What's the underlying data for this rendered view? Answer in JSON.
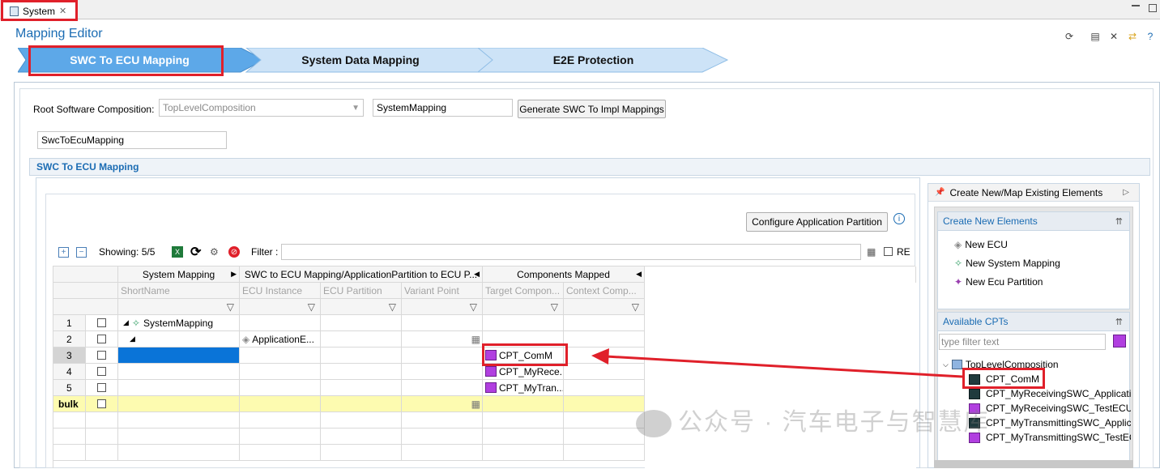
{
  "tab": {
    "label": "System"
  },
  "editor": {
    "title": "Mapping Editor"
  },
  "steps": [
    "SWC To ECU Mapping",
    "System Data Mapping",
    "E2E Protection"
  ],
  "form": {
    "root_label": "Root Software Composition:",
    "root_value": "TopLevelComposition",
    "system_mapping_value": "SystemMapping",
    "generate_button": "Generate SWC To Impl Mappings",
    "swc_to_ecu_value": "SwcToEcuMapping"
  },
  "section": {
    "title": "SWC To ECU Mapping"
  },
  "toolbar": {
    "configure_button": "Configure Application Partition",
    "showing": "Showing: 5/5",
    "filter_label": "Filter :",
    "re_label": "RE"
  },
  "table": {
    "group_headers": [
      "System Mapping",
      "SWC to ECU Mapping/ApplicationPartition to ECU P...",
      "Components Mapped"
    ],
    "columns": [
      "ShortName",
      "ECU Instance",
      "ECU Partition",
      "Variant Point",
      "Target Compon...",
      "Context Comp..."
    ],
    "rows": [
      {
        "num": "1",
        "short": "SystemMapping",
        "ecu": "",
        "target": ""
      },
      {
        "num": "2",
        "short": "",
        "ecu": "ApplicationE...",
        "target": ""
      },
      {
        "num": "3",
        "short": "",
        "ecu": "",
        "target": "CPT_ComM"
      },
      {
        "num": "4",
        "short": "",
        "ecu": "",
        "target": "CPT_MyRece..."
      },
      {
        "num": "5",
        "short": "",
        "ecu": "",
        "target": "CPT_MyTran..."
      },
      {
        "num": "bulk",
        "short": "",
        "ecu": "",
        "target": ""
      }
    ]
  },
  "right_panel": {
    "title": "Create New/Map Existing Elements",
    "create_header": "Create New Elements",
    "create_items": [
      "New ECU",
      "New System Mapping",
      "New Ecu Partition"
    ],
    "cpts_header": "Available CPTs",
    "filter_placeholder": "type filter text",
    "tree_root": "TopLevelComposition",
    "tree_items": [
      "CPT_ComM",
      "CPT_MyReceivingSWC_Applicatio",
      "CPT_MyReceivingSWC_TestECU",
      "CPT_MyTransmittingSWC_Applica",
      "CPT_MyTransmittingSWC_TestECU"
    ]
  },
  "watermark": "公众号 · 汽车电子与智慧库",
  "colors": {
    "accent": "#1b6cb3",
    "highlight": "#e0202a",
    "step_fill": "#5da8e8",
    "step_light": "#cde3f7",
    "selection": "#0a74d8",
    "bulk_row": "#fdfbb0"
  }
}
